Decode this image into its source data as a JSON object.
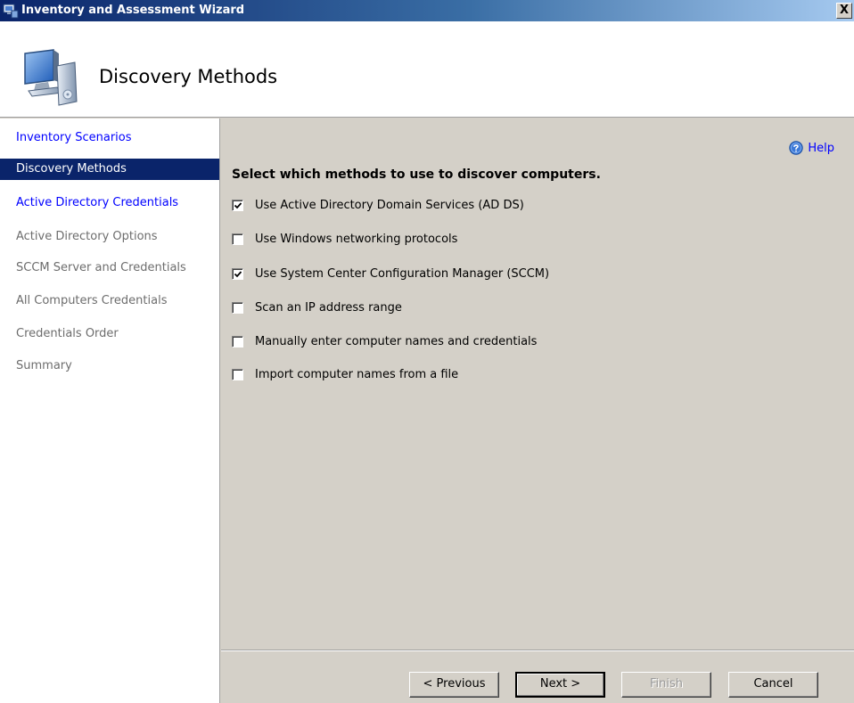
{
  "window": {
    "title": "Inventory and Assessment Wizard",
    "close_label": "X"
  },
  "header": {
    "title": "Discovery Methods",
    "icon": "computer-wizard-icon"
  },
  "sidebar": {
    "items": [
      {
        "label": "Inventory Scenarios",
        "state": "link"
      },
      {
        "label": "Discovery Methods",
        "state": "selected"
      },
      {
        "label": "Active Directory Credentials",
        "state": "link"
      },
      {
        "label": "Active Directory Options",
        "state": "disabled"
      },
      {
        "label": "SCCM Server and Credentials",
        "state": "disabled"
      },
      {
        "label": "All Computers Credentials",
        "state": "disabled"
      },
      {
        "label": "Credentials Order",
        "state": "disabled"
      },
      {
        "label": "Summary",
        "state": "disabled"
      }
    ]
  },
  "main": {
    "help_label": "Help",
    "heading": "Select which methods to use to discover computers.",
    "options": [
      {
        "label": "Use Active Directory Domain Services (AD DS)",
        "checked": true
      },
      {
        "label": "Use Windows networking protocols",
        "checked": false
      },
      {
        "label": "Use System Center Configuration Manager (SCCM)",
        "checked": true
      },
      {
        "label": "Scan an IP address range",
        "checked": false
      },
      {
        "label": "Manually enter computer names and credentials",
        "checked": false
      },
      {
        "label": "Import computer names from a file",
        "checked": false
      }
    ]
  },
  "footer": {
    "previous_label": "< Previous",
    "next_label": "Next >",
    "finish_label": "Finish",
    "cancel_label": "Cancel"
  },
  "colors": {
    "selected_bg": "#0a246a",
    "link": "#0000ff",
    "disabled_text": "#6d6d6d",
    "dialog_bg": "#d4d0c8"
  }
}
